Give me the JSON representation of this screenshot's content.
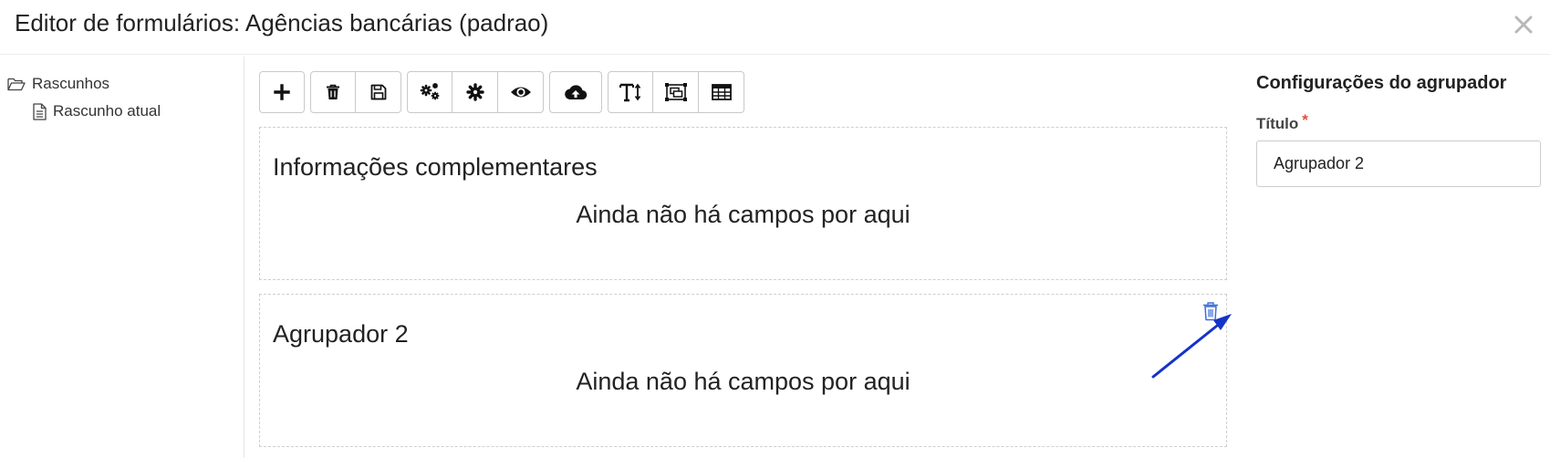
{
  "modal": {
    "title": "Editor de formulários: Agências bancárias (padrao)",
    "close_icon": "close-icon"
  },
  "tree": {
    "root": {
      "label": "Rascunhos",
      "icon": "folder-open-icon"
    },
    "children": [
      {
        "label": "Rascunho atual",
        "icon": "file-icon"
      }
    ]
  },
  "toolbar": {
    "groups": [
      [
        "plus-icon"
      ],
      [
        "trash-icon",
        "save-icon"
      ],
      [
        "gears-icon",
        "gear-icon",
        "eye-icon"
      ],
      [
        "cloud-upload-icon"
      ],
      [
        "text-height-icon",
        "object-group-icon",
        "table-icon"
      ]
    ]
  },
  "groups": [
    {
      "title": "Informações complementares",
      "empty_message": "Ainda não há campos por aqui"
    },
    {
      "title": "Agrupador 2",
      "empty_message": "Ainda não há campos por aqui"
    }
  ],
  "config": {
    "title": "Configurações do agrupador",
    "field_label": "Título",
    "required_mark": "*",
    "title_value": "Agrupador 2"
  },
  "colors": {
    "annotation_arrow": "#1533c9",
    "delete_icon": "#3c6fd9",
    "required": "#e74c3c"
  }
}
